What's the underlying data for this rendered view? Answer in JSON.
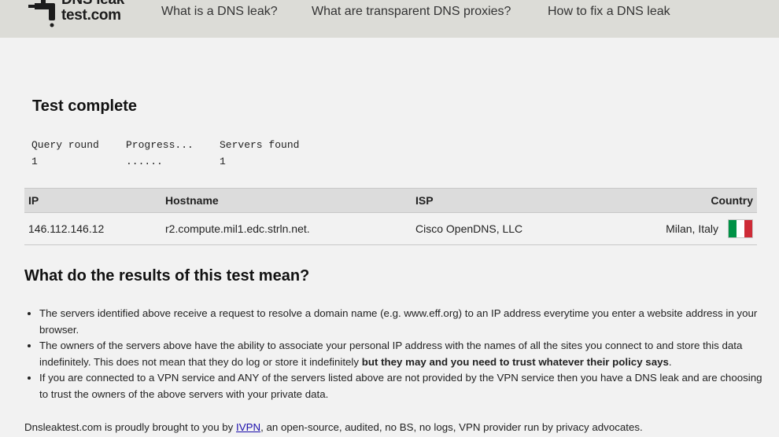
{
  "header": {
    "logo_line1": "DNS leak",
    "logo_line2": "test.com",
    "nav": [
      {
        "label": "What is a DNS leak?"
      },
      {
        "label": "What are transparent DNS proxies?"
      },
      {
        "label": "How to fix a DNS leak"
      }
    ]
  },
  "test": {
    "title": "Test complete",
    "progress": {
      "query_round_label": "Query round",
      "query_round_value": "1",
      "progress_label": "Progress...",
      "progress_value": "......",
      "servers_found_label": "Servers found",
      "servers_found_value": "1"
    }
  },
  "results": {
    "columns": [
      "IP",
      "Hostname",
      "ISP",
      "Country"
    ],
    "rows": [
      {
        "ip": "146.112.146.12",
        "hostname": "r2.compute.mil1.edc.strln.net.",
        "isp": "Cisco OpenDNS, LLC",
        "country": "Milan, Italy",
        "flag_icon": "italy-flag-icon",
        "flag_colors": [
          "#009246",
          "#ffffff",
          "#ce2b37"
        ]
      }
    ]
  },
  "explanation": {
    "title": "What do the results of this test mean?",
    "bullets": [
      {
        "text": "The servers identified above receive a request to resolve a domain name (e.g. www.eff.org) to an IP address everytime you enter a website address in your browser."
      },
      {
        "text": "The owners of the servers above have the ability to associate your personal IP address with the names of all the sites you connect to and store this data indefinitely. This does not mean that they do log or store it indefinitely ",
        "bold": "but they may and you need to trust whatever their policy says",
        "end": "."
      },
      {
        "text": "If you are connected to a VPN service and ANY of the servers listed above are not provided by the VPN service then you have a DNS leak and are choosing to trust the owners of the above servers with your private data."
      }
    ]
  },
  "footer": {
    "prefix": "Dnsleaktest.com is proudly brought to you by ",
    "link": "IVPN",
    "suffix": ", an open-source, audited, no BS, no logs, VPN provider run by privacy advocates."
  },
  "colors": {
    "header_bg": "#dcdcd7",
    "page_bg": "#f2f2f2",
    "table_header_bg": "#dcdcdc",
    "link": "#1a0dab"
  }
}
